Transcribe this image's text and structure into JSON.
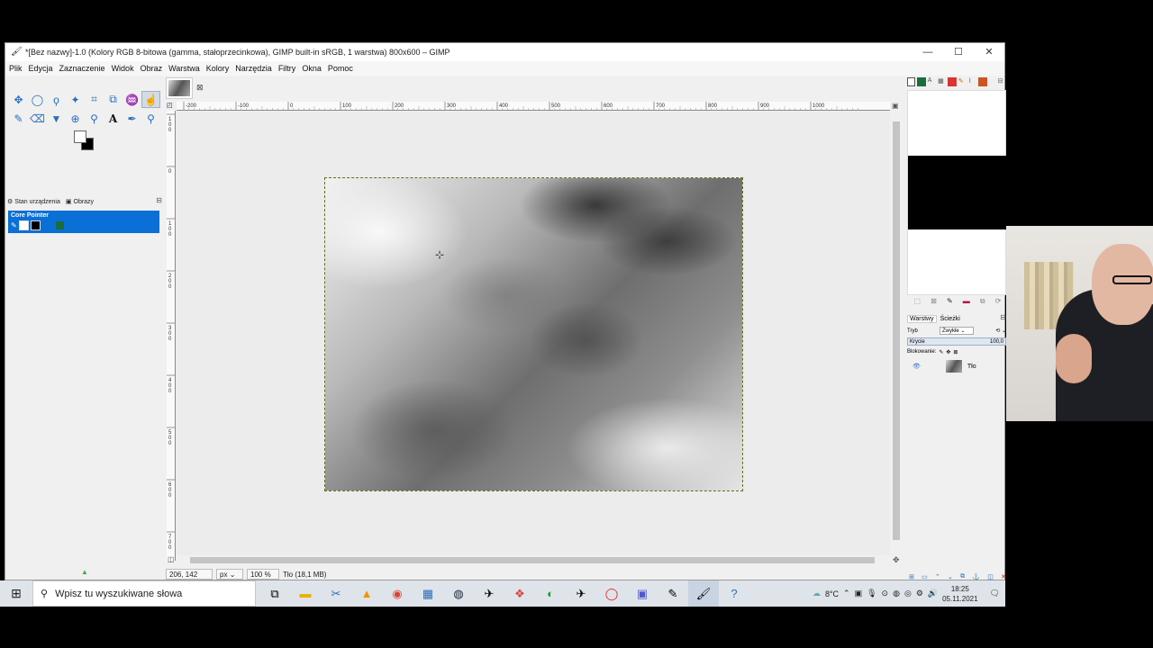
{
  "window": {
    "title": "*[Bez nazwy]-1.0 (Kolory RGB 8-bitowa (gamma, stałoprzecinkowa), GIMP built-in sRGB, 1 warstwa) 800x600 – GIMP",
    "min_glyph": "—",
    "max_glyph": "☐",
    "close_glyph": "✕"
  },
  "menu": [
    "Plik",
    "Edycja",
    "Zaznaczenie",
    "Widok",
    "Obraz",
    "Warstwa",
    "Kolory",
    "Narzędzia",
    "Filtry",
    "Okna",
    "Pomoc"
  ],
  "toolbox": {
    "row1_icons": [
      "move-icon",
      "ellipse-select-icon",
      "lasso-icon",
      "fuzzy-select-icon",
      "crop-icon",
      "unified-transform-icon",
      "warp-icon",
      "foreground-select-icon"
    ],
    "row2_icons": [
      "paintbrush-icon",
      "eraser-icon",
      "bucket-fill-icon",
      "clone-icon",
      "dodge-icon",
      "text-icon",
      "color-picker-icon",
      "zoom-icon"
    ],
    "device_tabs": [
      "Stan urządzenia",
      "Obrazy"
    ],
    "core_pointer_label": "Core Pointer",
    "swatch_colors": [
      "#ffffff",
      "#000000",
      "#1a6e3c"
    ]
  },
  "canvas": {
    "ruler_labels": [
      "-200",
      "-100",
      "0",
      "100",
      "200",
      "300",
      "400",
      "500",
      "600",
      "700",
      "800",
      "900",
      "1000"
    ],
    "left_ruler_labels": [
      "100",
      "0",
      "100",
      "200",
      "300",
      "400",
      "500",
      "600",
      "700"
    ]
  },
  "status": {
    "coords": "206, 142",
    "unit": "px",
    "zoom": "100 %",
    "info": "Tło (18,1 MB)"
  },
  "layers": {
    "tabs": [
      "Warstwy",
      "Ścieżki"
    ],
    "mode_label": "Tryb",
    "mode_value": "Zwykłe",
    "opacity_label": "Krycie",
    "opacity_value": "100,0",
    "lock_label": "Blokowanie:",
    "layer_name": "Tło"
  },
  "taskbar": {
    "search_placeholder": "Wpisz tu wyszukiwane słowa",
    "temperature": "8°C",
    "time": "18:25",
    "date": "05.11.2021",
    "apps": [
      "task-view-icon",
      "file-explorer-icon",
      "snipping-icon",
      "vlc-icon",
      "chrome-icon",
      "app-icon",
      "steam-icon",
      "app2-icon",
      "app3-icon",
      "app4-icon",
      "app5-icon",
      "opera-icon",
      "teams-icon",
      "app6-icon",
      "gimp-icon",
      "help-icon"
    ]
  },
  "colors": {
    "accent": "#0a6fd6",
    "taskbar_bg": "#dfe4ea"
  }
}
